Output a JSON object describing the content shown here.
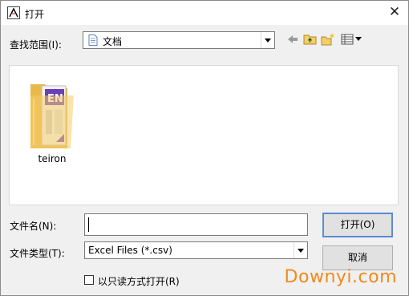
{
  "dialog": {
    "title": "打开",
    "close_glyph": "✕"
  },
  "lookin": {
    "label": "查找范围(I):",
    "value": "文档"
  },
  "toolbar": {
    "icons": [
      "back-arrow-icon",
      "up-folder-icon",
      "new-folder-icon",
      "view-menu-icon"
    ]
  },
  "files": [
    {
      "name": "teiron",
      "icon": "folder-with-en-document-icon",
      "badge": "EN"
    }
  ],
  "filename": {
    "label": "文件名(N):",
    "value": ""
  },
  "filetype": {
    "label": "文件类型(T):",
    "value": "Excel Files (*.csv)"
  },
  "buttons": {
    "open": "打开(O)",
    "cancel": "取消"
  },
  "readonly": {
    "label": "以只读方式打开(R)",
    "checked": false
  },
  "watermark": "Downyi.com",
  "colors": {
    "accent": "#5b8ad6",
    "folder": "#f5cd6a",
    "en_badge": "#6b3fb5",
    "watermark": "#f08a1c"
  }
}
